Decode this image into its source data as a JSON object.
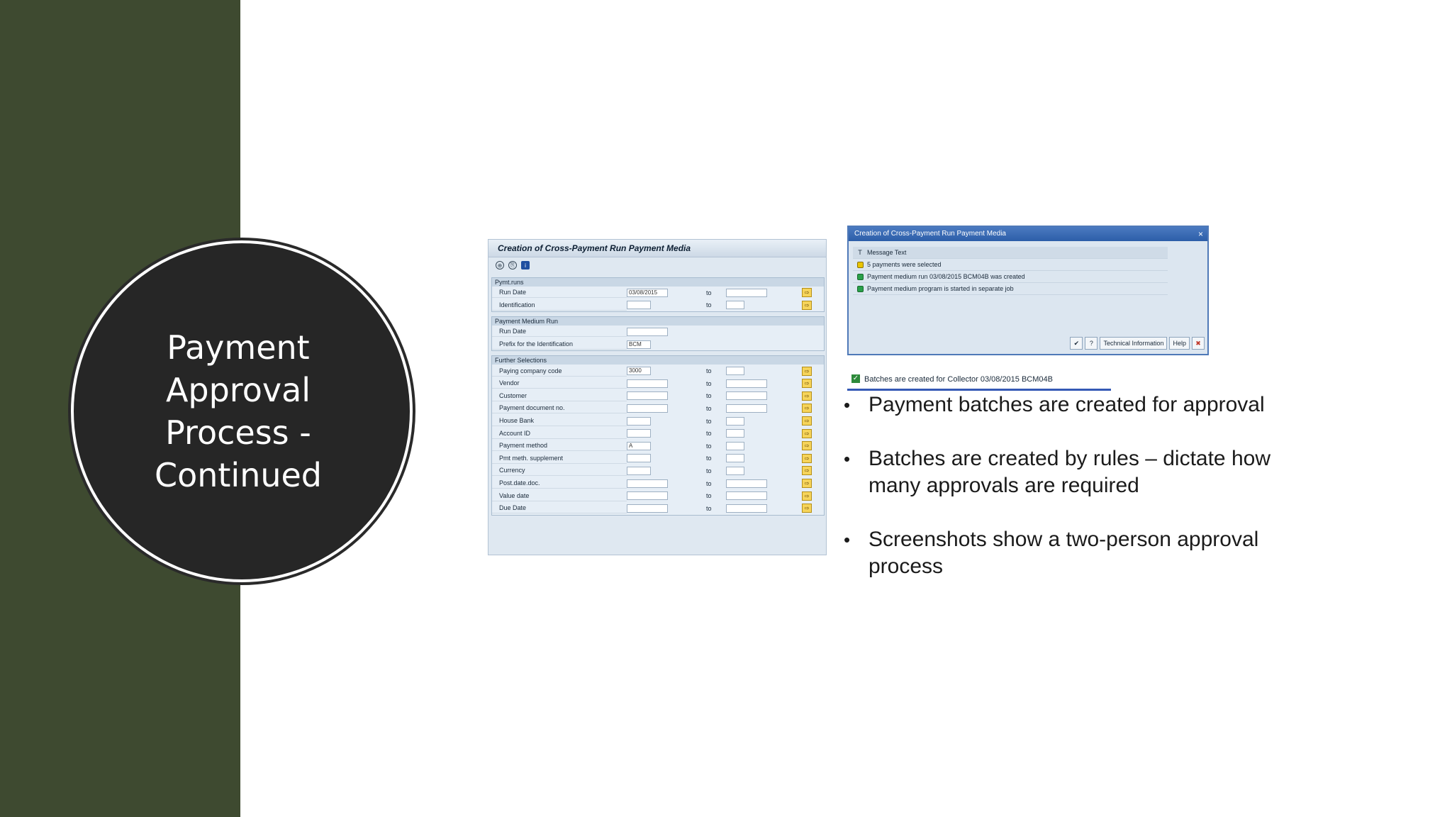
{
  "slide": {
    "title": "Payment Approval Process - Continued"
  },
  "sap_screen": {
    "title": "Creation of Cross-Payment Run Payment Media",
    "groups": [
      {
        "title": "Pymt.runs",
        "rows": [
          {
            "label": "Run Date",
            "from": "03/08/2015",
            "to_label": "to"
          },
          {
            "label": "Identification",
            "from": "",
            "to_label": "to"
          }
        ]
      },
      {
        "title": "Payment Medium Run",
        "rows": [
          {
            "label": "Run Date",
            "from": ""
          },
          {
            "label": "Prefix for the Identification",
            "from": "BCM"
          }
        ]
      },
      {
        "title": "Further Selections",
        "rows": [
          {
            "label": "Paying company code",
            "from": "3000",
            "to_label": "to"
          },
          {
            "label": "Vendor",
            "from": "",
            "to_label": "to"
          },
          {
            "label": "Customer",
            "from": "",
            "to_label": "to"
          },
          {
            "label": "Payment document no.",
            "from": "",
            "to_label": "to"
          },
          {
            "label": "House Bank",
            "from": "",
            "to_label": "to"
          },
          {
            "label": "Account ID",
            "from": "",
            "to_label": "to"
          },
          {
            "label": "Payment method",
            "from": "A",
            "to_label": "to"
          },
          {
            "label": "Pmt meth. supplement",
            "from": "",
            "to_label": "to"
          },
          {
            "label": "Currency",
            "from": "",
            "to_label": "to"
          },
          {
            "label": "Post.date.doc.",
            "from": "",
            "to_label": "to"
          },
          {
            "label": "Value date",
            "from": "",
            "to_label": "to"
          },
          {
            "label": "Due Date",
            "from": "",
            "to_label": "to"
          }
        ]
      }
    ]
  },
  "dialog": {
    "title": "Creation of Cross-Payment Run Payment Media",
    "col_type": "T",
    "col_text": "Message Text",
    "messages": [
      "5 payments were selected",
      "Payment medium run 03/08/2015 BCM04B was created",
      "Payment medium program is started in separate job"
    ],
    "buttons": {
      "tech": "Technical Information",
      "help": "Help"
    }
  },
  "status_bar": "Batches are created for Collector 03/08/2015 BCM04B",
  "bullets": [
    "Payment batches are created for approval",
    "Batches are created by rules – dictate how many approvals are required",
    "Screenshots show a two-person approval process"
  ]
}
